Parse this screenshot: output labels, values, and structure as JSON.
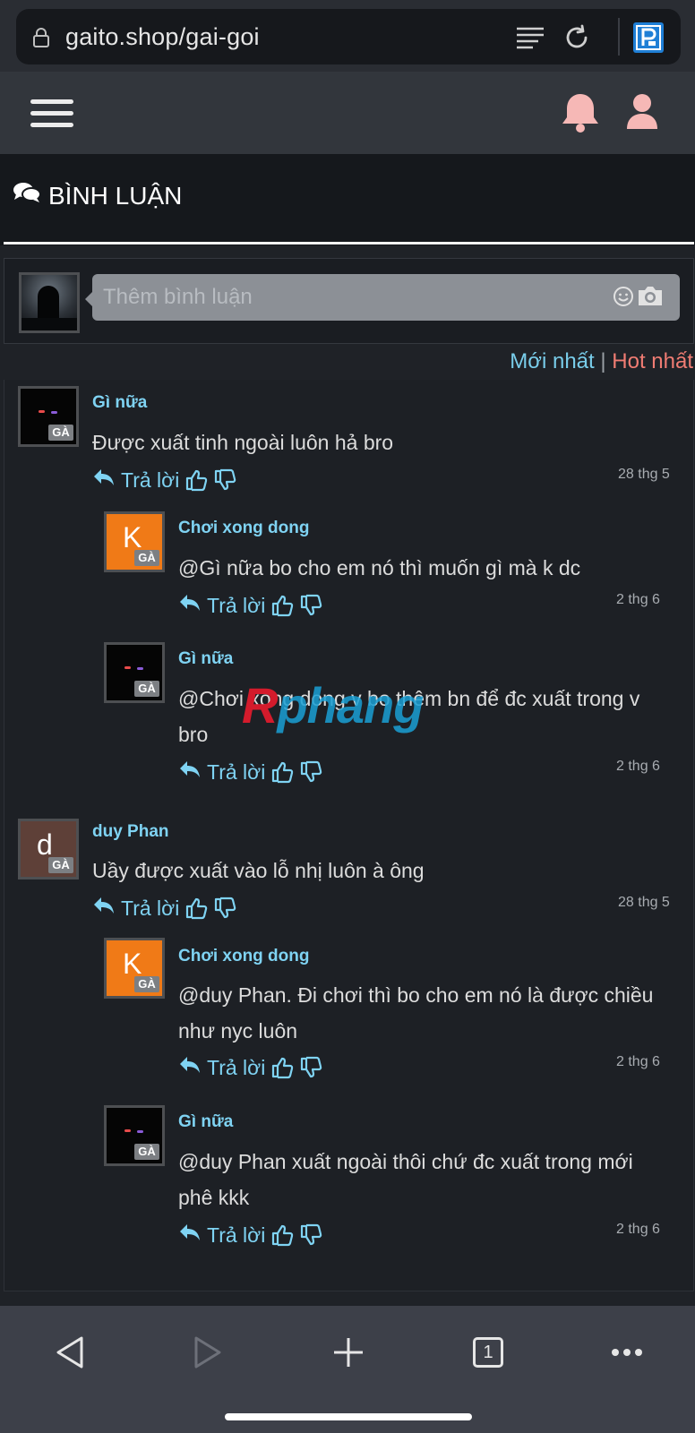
{
  "browser": {
    "url": "gaito.shop/gai-goi",
    "tab_count": "1"
  },
  "section": {
    "title": "BÌNH LUẬN"
  },
  "comment_input": {
    "placeholder": "Thêm bình luận"
  },
  "sort": {
    "newest": "Mới nhất",
    "separator": "|",
    "hot": "Hot nhất"
  },
  "reply_label": "Trả lời",
  "badge_label": "GÀ",
  "watermark": {
    "part1": "R",
    "part2": "phang"
  },
  "comments": [
    {
      "name": "Gì nữa",
      "text": "Được xuất tinh ngoài luôn hả bro",
      "time": "28 thg 5",
      "avatar": "dark",
      "initial": ""
    },
    {
      "name": "Chơi xong dong",
      "text": "@Gì nữa bo cho em nó thì muốn gì mà k dc",
      "time": "2 thg 6",
      "avatar": "orange",
      "initial": "K"
    },
    {
      "name": "Gì nữa",
      "text": "@Chơi xong dong v bo thêm bn để đc xuất trong v bro",
      "time": "2 thg 6",
      "avatar": "dark",
      "initial": ""
    },
    {
      "name": "duy Phan",
      "text": "Uầy được xuất vào lỗ nhị luôn à ông",
      "time": "28 thg 5",
      "avatar": "brown",
      "initial": "d"
    },
    {
      "name": "Chơi xong dong",
      "text": "@duy Phan. Đi chơi thì bo cho em nó là được chiều như nyc luôn",
      "time": "2 thg 6",
      "avatar": "orange",
      "initial": "K"
    },
    {
      "name": "Gì nữa",
      "text": "@duy Phan xuất ngoài thôi chứ đc xuất trong mới phê kkk",
      "time": "2 thg 6",
      "avatar": "dark",
      "initial": ""
    }
  ],
  "colors": {
    "accent": "#7fd3f3",
    "hot": "#f07c73",
    "bell": "#f6b8b6",
    "background": "#1f2227"
  },
  "icons": {
    "url_bar": [
      "lock-icon",
      "reader-mode-icon",
      "reload-icon",
      "parking-app-icon"
    ],
    "header": [
      "hamburger-menu-icon",
      "bell-icon",
      "user-icon"
    ],
    "comment_actions": [
      "reply-arrow-icon",
      "thumbs-up-icon",
      "thumbs-down-icon"
    ],
    "nav": [
      "back-icon",
      "forward-icon",
      "new-tab-icon",
      "tabs-icon",
      "more-icon"
    ]
  }
}
